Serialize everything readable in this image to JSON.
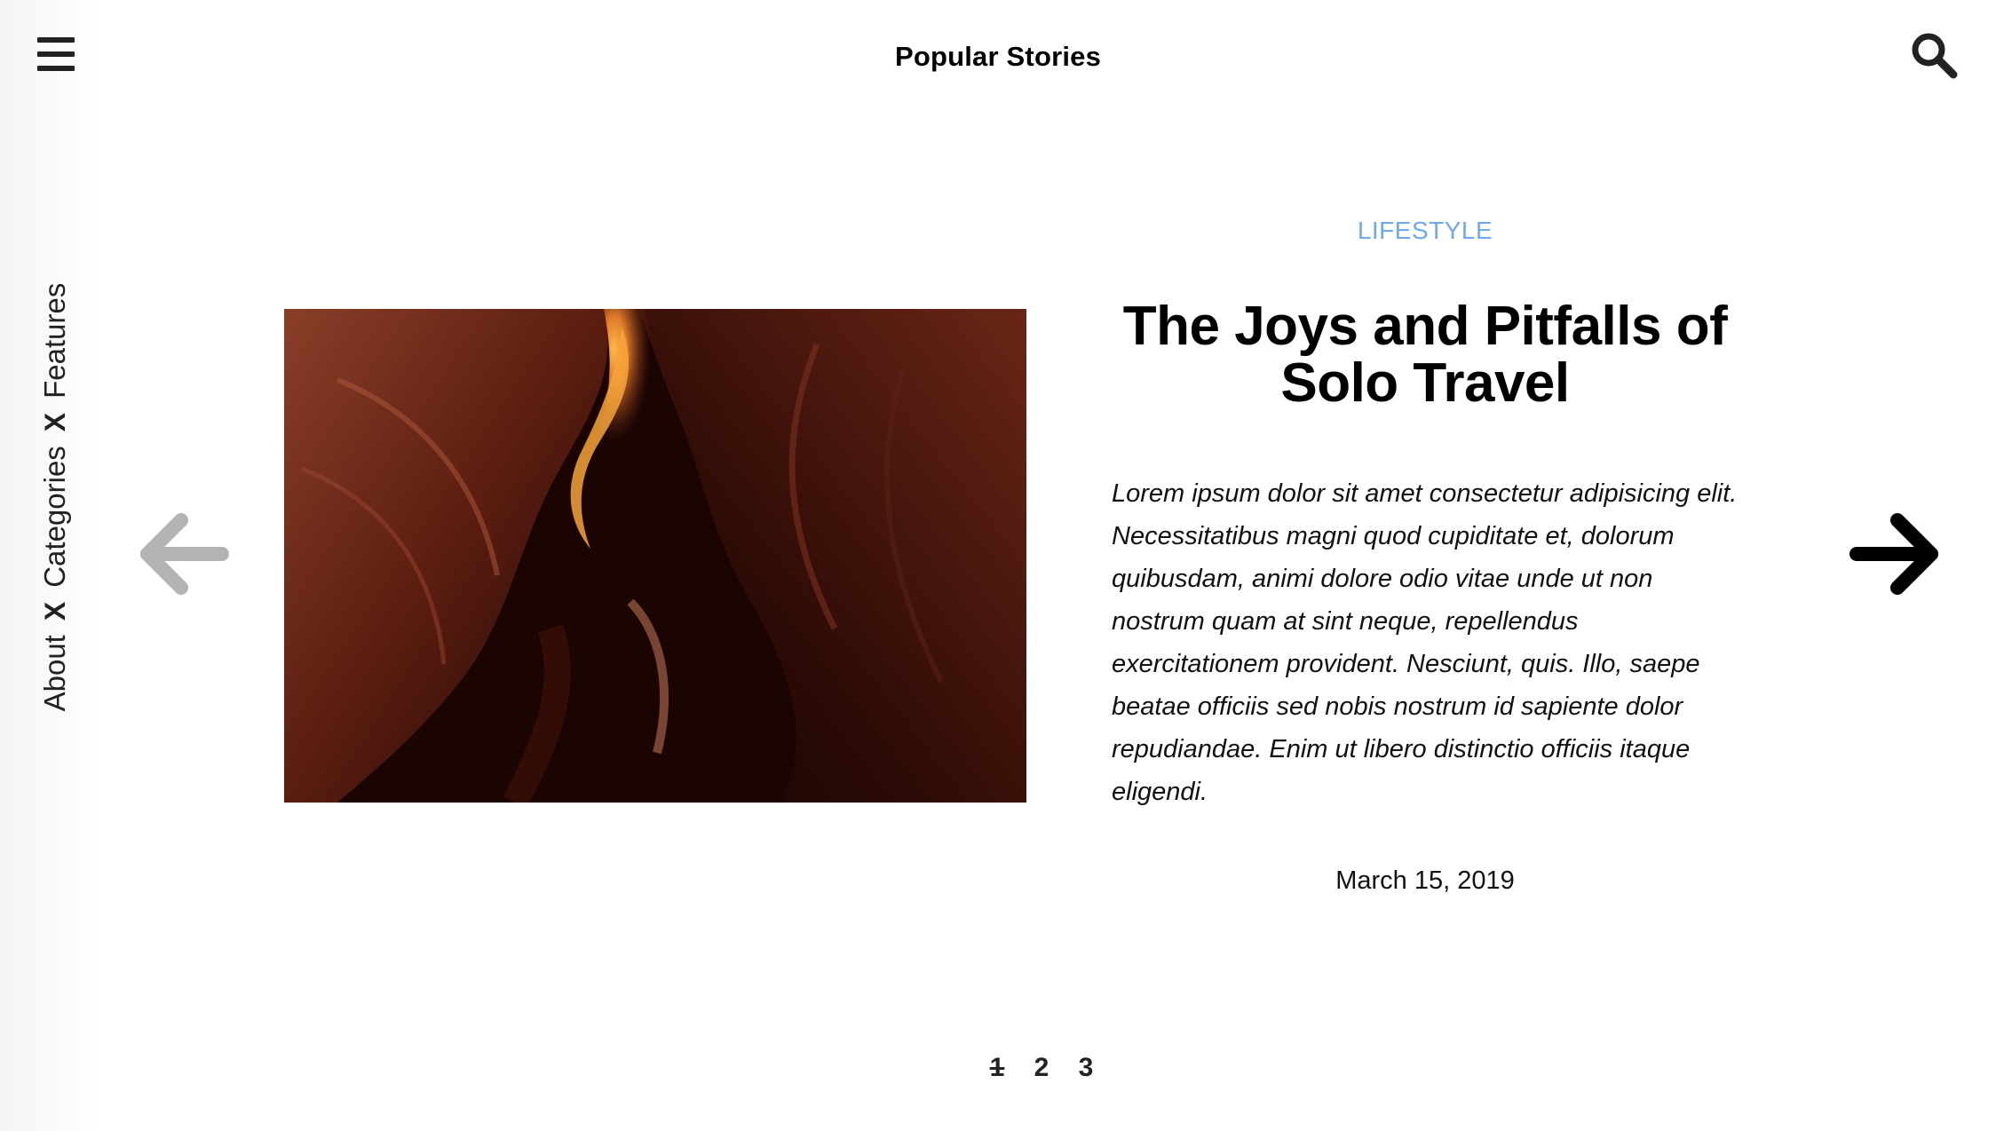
{
  "header": {
    "title": "Popular Stories",
    "menu_icon": "hamburger-menu-icon",
    "search_icon": "search-icon"
  },
  "side_nav": {
    "items": [
      "About",
      "Categories",
      "Features"
    ],
    "separator": "X"
  },
  "slider": {
    "prev_icon": "arrow-left-icon",
    "next_icon": "arrow-right-icon",
    "prev_color": "#b3b3b3",
    "next_color": "#000000"
  },
  "article": {
    "category": "LIFESTYLE",
    "title": "The Joys and Pitfalls of Solo Travel",
    "excerpt": "Lorem ipsum dolor sit amet consectetur adipisicing elit. Necessitatibus magni quod cupiditate et, dolorum quibusdam, animi dolore odio vitae unde ut non nostrum quam at sint neque, repellendus exercitationem provident. Nesciunt, quis. Illo, saepe beatae officiis sed nobis nostrum id sapiente dolor repudiandae. Enim ut libero distinctio officiis itaque eligendi.",
    "date": "March 15, 2019",
    "image": "canyon-photo"
  },
  "pagination": {
    "pages": [
      "1",
      "2",
      "3"
    ],
    "current": "1"
  },
  "colors": {
    "accent": "#6fa8ec",
    "text": "#000000"
  }
}
